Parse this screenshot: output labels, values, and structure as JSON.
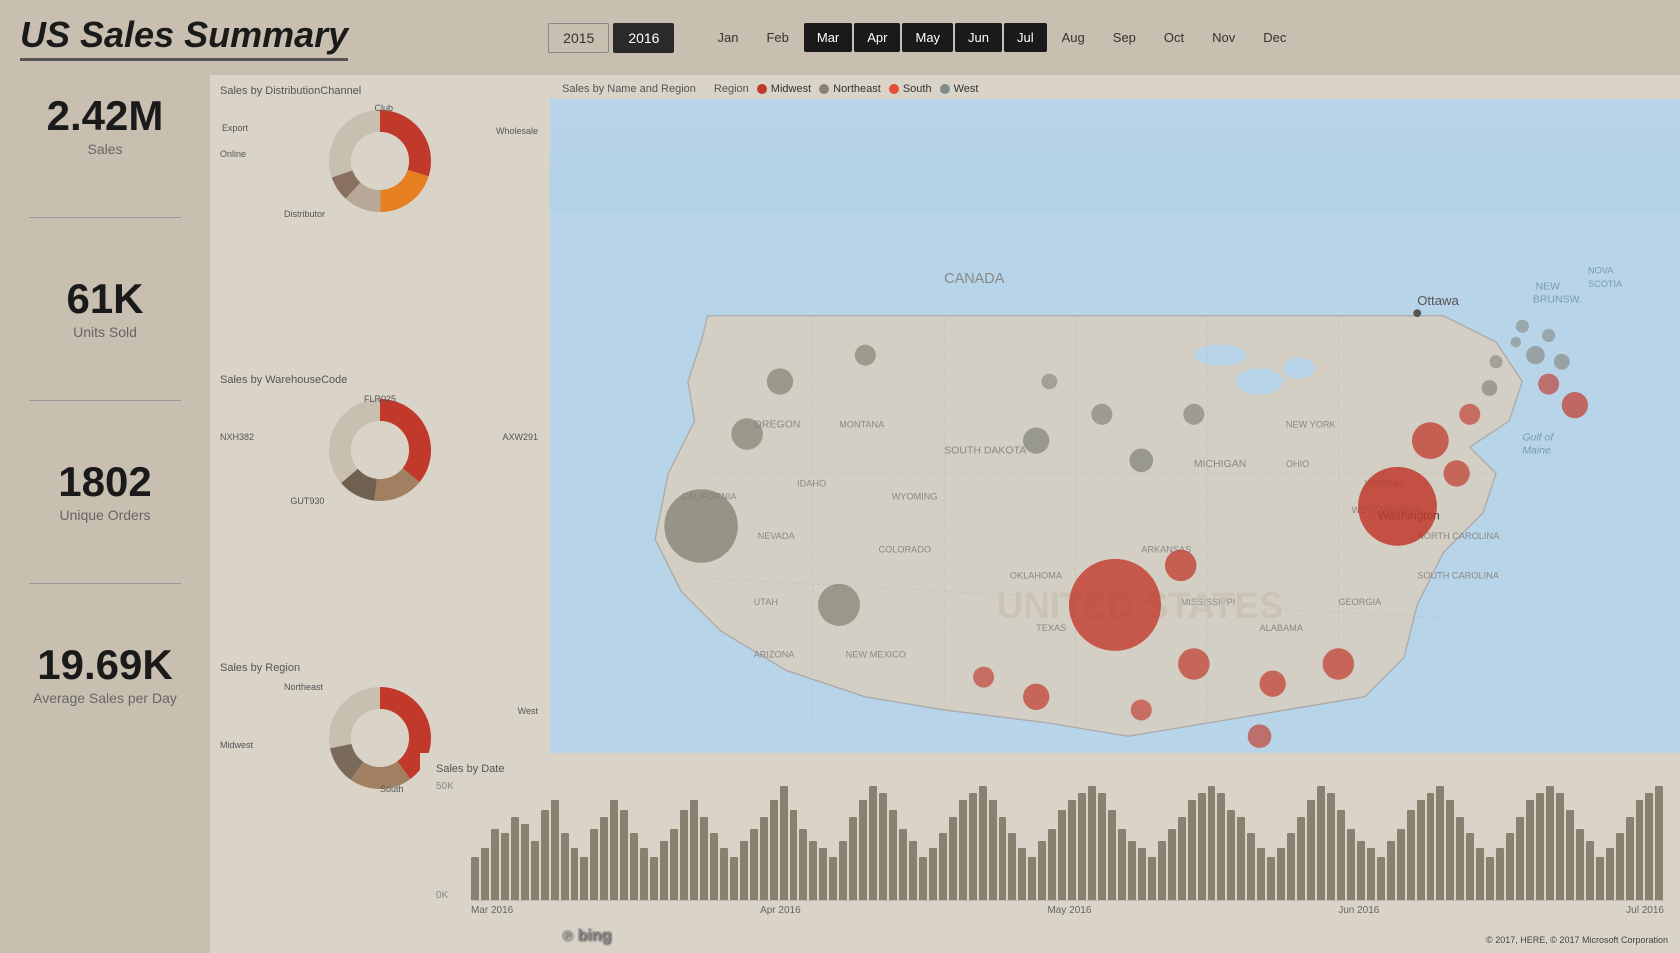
{
  "header": {
    "title": "US Sales Summary",
    "years": [
      {
        "label": "2015",
        "active": false
      },
      {
        "label": "2016",
        "active": true
      }
    ],
    "months": [
      {
        "label": "Jan",
        "active": false
      },
      {
        "label": "Feb",
        "active": false
      },
      {
        "label": "Mar",
        "active": true,
        "highlighted": true
      },
      {
        "label": "Apr",
        "active": true,
        "highlighted": true
      },
      {
        "label": "May",
        "active": true,
        "highlighted": true
      },
      {
        "label": "Jun",
        "active": true,
        "highlighted": true
      },
      {
        "label": "Jul",
        "active": true,
        "highlighted": true
      },
      {
        "label": "Aug",
        "active": false
      },
      {
        "label": "Sep",
        "active": false
      },
      {
        "label": "Oct",
        "active": false
      },
      {
        "label": "Nov",
        "active": false
      },
      {
        "label": "Dec",
        "active": false
      }
    ]
  },
  "kpis": [
    {
      "value": "2.42M",
      "label": "Sales"
    },
    {
      "value": "61K",
      "label": "Units Sold"
    },
    {
      "value": "1802",
      "label": "Unique Orders"
    },
    {
      "value": "19.69K",
      "label": "Average Sales per Day"
    }
  ],
  "charts": {
    "distribution_channel": {
      "title": "Sales by DistributionChannel",
      "labels": [
        "Club",
        "Export",
        "Online",
        "Wholesale",
        "Distributor"
      ],
      "label_positions": [
        {
          "label": "Club",
          "x": "55%",
          "y": "5%"
        },
        {
          "label": "Export",
          "x": "5%",
          "y": "20%"
        },
        {
          "label": "Online",
          "x": "2%",
          "y": "52%"
        },
        {
          "label": "Wholesale",
          "x": "70%",
          "y": "28%"
        },
        {
          "label": "Distributor",
          "x": "20%",
          "y": "88%"
        }
      ]
    },
    "warehouse_code": {
      "title": "Sales by WarehouseCode",
      "labels": [
        "FLR025",
        "NXH382",
        "AXW291",
        "GUT930"
      ],
      "label_positions": [
        {
          "label": "FLR025",
          "x": "48%",
          "y": "2%"
        },
        {
          "label": "NXH382",
          "x": "2%",
          "y": "40%"
        },
        {
          "label": "AXW291",
          "x": "72%",
          "y": "38%"
        },
        {
          "label": "GUT930",
          "x": "18%",
          "y": "88%"
        }
      ]
    },
    "region": {
      "title": "Sales by Region",
      "labels": [
        "Northeast",
        "West",
        "Midwest",
        "South"
      ],
      "label_positions": [
        {
          "label": "Northeast",
          "x": "30%",
          "y": "2%"
        },
        {
          "label": "West",
          "x": "72%",
          "y": "28%"
        },
        {
          "label": "Midwest",
          "x": "2%",
          "y": "62%"
        },
        {
          "label": "South",
          "x": "55%",
          "y": "88%"
        }
      ]
    }
  },
  "map": {
    "title": "Sales by Name and Region",
    "legend_label": "Region",
    "regions": [
      {
        "name": "Midwest",
        "color": "#c0392b"
      },
      {
        "name": "Northeast",
        "color": "#95a5a6"
      },
      {
        "name": "South",
        "color": "#e74c3c"
      },
      {
        "name": "West",
        "color": "#7f8c8d"
      }
    ],
    "bing_logo": "bing",
    "copyright": "© 2017, HERE, © 2017 Microsoft Corporation"
  },
  "bar_chart": {
    "title": "Sales by Date",
    "y_max": "50K",
    "y_min": "0K",
    "x_labels": [
      "Mar 2016",
      "Apr 2016",
      "May 2016",
      "Jun 2016",
      "Jul 2016"
    ]
  },
  "bars": [
    18,
    22,
    30,
    28,
    35,
    32,
    25,
    38,
    42,
    28,
    22,
    18,
    30,
    35,
    42,
    38,
    28,
    22,
    18,
    25,
    30,
    38,
    42,
    35,
    28,
    22,
    18,
    25,
    30,
    35,
    42,
    48,
    38,
    30,
    25,
    22,
    18,
    25,
    35,
    42,
    48,
    45,
    38,
    30,
    25,
    18,
    22,
    28,
    35,
    42,
    45,
    48,
    42,
    35,
    28,
    22,
    18,
    25,
    30,
    38,
    42,
    45,
    48,
    45,
    38,
    30,
    25,
    22,
    18,
    25,
    30,
    35,
    42,
    45,
    48,
    45,
    38,
    35,
    28,
    22,
    18,
    22,
    28,
    35,
    42,
    48,
    45,
    38,
    30,
    25,
    22,
    18,
    25,
    30,
    38,
    42,
    45,
    48,
    42,
    35,
    28,
    22,
    18,
    22,
    28,
    35,
    42,
    45,
    48,
    45,
    38,
    30,
    25,
    18,
    22,
    28,
    35,
    42,
    45,
    48
  ]
}
